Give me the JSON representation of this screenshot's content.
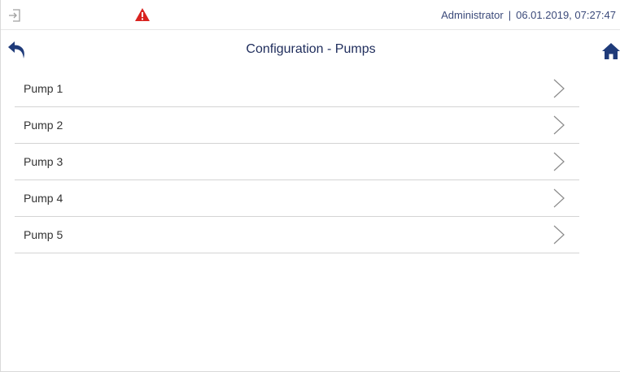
{
  "status_bar": {
    "user": "Administrator",
    "separator": "|",
    "datetime": "06.01.2019, 07:27:47",
    "icons": [
      "login-icon",
      "warning-icon"
    ],
    "warning_color": "#d9231f"
  },
  "title_bar": {
    "title": "Configuration - Pumps",
    "icons": [
      "back-arrow-icon",
      "home-icon"
    ],
    "icon_color": "#1f3b7a"
  },
  "pumps": [
    {
      "label": "Pump 1"
    },
    {
      "label": "Pump 2"
    },
    {
      "label": "Pump 3"
    },
    {
      "label": "Pump 4"
    },
    {
      "label": "Pump 5"
    }
  ]
}
